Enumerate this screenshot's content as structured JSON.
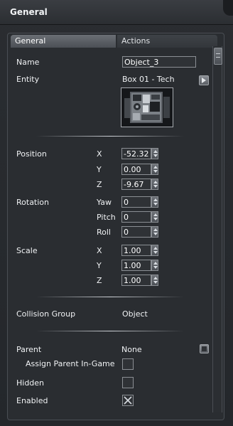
{
  "window": {
    "title": "General"
  },
  "tabs": [
    {
      "label": "General"
    },
    {
      "label": "Actions"
    }
  ],
  "name": {
    "label": "Name",
    "value": "Object_3"
  },
  "entity": {
    "label": "Entity",
    "value": "Box 01 - Tech",
    "picker_icon": "arrow-right-icon"
  },
  "position": {
    "label": "Position",
    "x_label": "X",
    "y_label": "Y",
    "z_label": "Z",
    "x": "-52.32",
    "y": "0.00",
    "z": "-9.67"
  },
  "rotation": {
    "label": "Rotation",
    "yaw_label": "Yaw",
    "pitch_label": "Pitch",
    "roll_label": "Roll",
    "yaw": "0",
    "pitch": "0",
    "roll": "0"
  },
  "scale": {
    "label": "Scale",
    "x_label": "X",
    "y_label": "Y",
    "z_label": "Z",
    "x": "1.00",
    "y": "1.00",
    "z": "1.00"
  },
  "collision": {
    "label": "Collision Group",
    "value": "Object"
  },
  "parent": {
    "label": "Parent",
    "value": "None"
  },
  "assign_parent": {
    "label": "Assign Parent In-Game",
    "checked": false
  },
  "hidden": {
    "label": "Hidden",
    "checked": false
  },
  "enabled": {
    "label": "Enabled",
    "checked": true
  },
  "colors": {
    "accent_tab": "#5c6066",
    "panel_bg": "#2a2d31",
    "field_border": "#8b8f94"
  }
}
